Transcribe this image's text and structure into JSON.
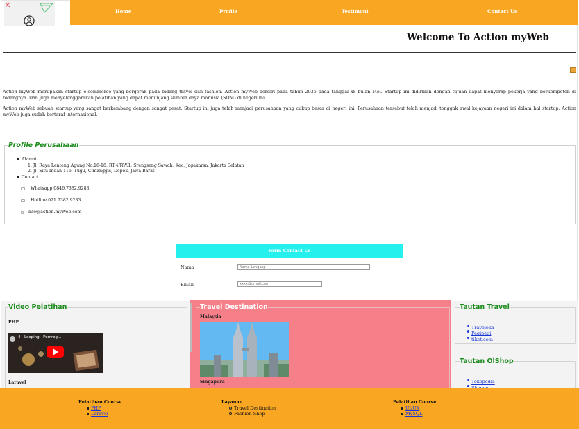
{
  "nav": {
    "items": [
      {
        "label": "Home"
      },
      {
        "label": "Profile"
      },
      {
        "label": "Testimoni"
      },
      {
        "label": "Contact Us"
      }
    ]
  },
  "header": {
    "welcome": "Welcome To Action myWeb"
  },
  "intro": {
    "paragraph1": "Action myWeb merupakan startup e-commerce yang bergerak pada bidang travel dan fashion. Action myWeb berdiri pada tahun 2035 pada tanggal xx bulan Mei. Startup ini didirikan dengan tujuan dapat menyerap pekerja yang berkompeten di bidangnya. Dan juga menyelenggarakan pelatihan yang dapat menunjang sumber daya manusia (SDM) di negeri ini.",
    "paragraph2": "Action myWeb sebuah startup yang sangat berkembang dengan sangat pesat. Startup ini juga telah menjadi perusahaan yang cukup besar di negeri ini. Perusahaan tersebut telah menjadi tonggak awal kejayaan negeri ini dalam hal startup. Action myWeb juga sudah bertaraf internasional."
  },
  "profile": {
    "legend": "Profile Perusahaan",
    "alamat_label": "Alamat",
    "alamat": [
      "Jl. Raya Lenteng Agung No.16-18, RT.4/RW.1, Srengseng Sawah, Kec. Jagakarsa, Jakarta Selatan",
      "Jl. Situ Indah 116, Tugu, Cimanggis, Depok, Jawa Barat"
    ],
    "contact_label": "Contact",
    "contacts": [
      "Whatsapp 0846.7382.9283",
      "Hotline 021.7382.9283",
      "info@action.myWeb.com"
    ]
  },
  "form": {
    "title": "Form Contact Us",
    "nama_label": "Nama",
    "nama_placeholder": "Nama Lengkap",
    "email_label": "Email",
    "email_placeholder": "xxxx@gmail.com"
  },
  "video": {
    "legend": "Video Pelatihan",
    "item1": "PHP",
    "thumb_title": "4 - Looping - Pemrog...",
    "item2": "Laravel"
  },
  "travel": {
    "legend": "Travel Destination",
    "dest1": "Malaysia",
    "dest2": "Singapura"
  },
  "tautan_travel": {
    "legend": "Tautan Travel",
    "links": [
      "Traveloka",
      "Pegipegi",
      "tiket.com"
    ]
  },
  "tautan_olshop": {
    "legend": "Tautan OlShop",
    "links": [
      "Tokopedia",
      "Shopee"
    ]
  },
  "footer": {
    "col1_title": "Pelatihan Course",
    "col1_items": [
      "PHP",
      "Laravel"
    ],
    "col2_title": "Layanan",
    "col2_items": [
      "Travel Destination",
      "Fashion Shop"
    ],
    "col3_title": "Pelatihan Course",
    "col3_items": [
      "UI/UX",
      "MySQL"
    ]
  },
  "colors": {
    "navbar": "#f9a723",
    "form_header": "#25f0ee",
    "travel_panel": "#f58089",
    "legend_green": "#1d8b1d",
    "link_blue": "#1a37d6"
  }
}
